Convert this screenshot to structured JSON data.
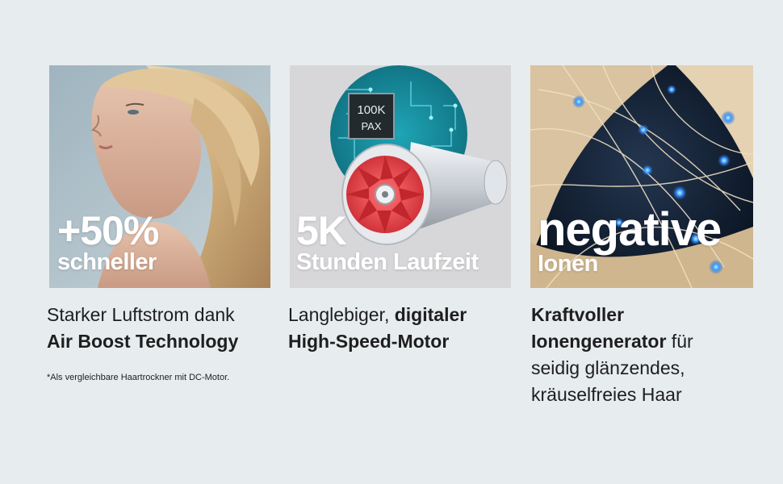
{
  "cards": [
    {
      "big_number": "+50%",
      "big_subtitle": "schneller",
      "desc_line1_plain": "Starker Luftstrom dank",
      "desc_line2_bold": "Air Boost Technology",
      "footnote": "*Als vergleichbare Haartrockner mit DC-Motor."
    },
    {
      "big_number": "5K",
      "big_subtitle": "Stunden Laufzeit",
      "chip_label_top": "100K",
      "chip_label_bottom": "PAX",
      "desc_line1_plain": "Langlebiger, ",
      "desc_line1_bold": "digitaler",
      "desc_line2_bold": "High-Speed-Motor"
    },
    {
      "big_number": "negative",
      "big_subtitle": "Ionen",
      "desc_line1_bold": "Kraftvoller",
      "desc_line2_bold": "Ionengenerator",
      "desc_line2_plain": " für",
      "desc_line3_plain": "seidig glänzendes,",
      "desc_line4_plain": "kräuselfreies Haar"
    }
  ],
  "colors": {
    "background": "#e7ecee",
    "text": "#1e1e1e",
    "overlay_text": "#ffffff",
    "ion_blue": "#2f8cff",
    "circuit_teal": "#1a8ea0",
    "fan_red": "#e8454b"
  },
  "icons": [
    "woman-hair-photo",
    "motor-chip-illustration",
    "ion-hair-photo"
  ]
}
